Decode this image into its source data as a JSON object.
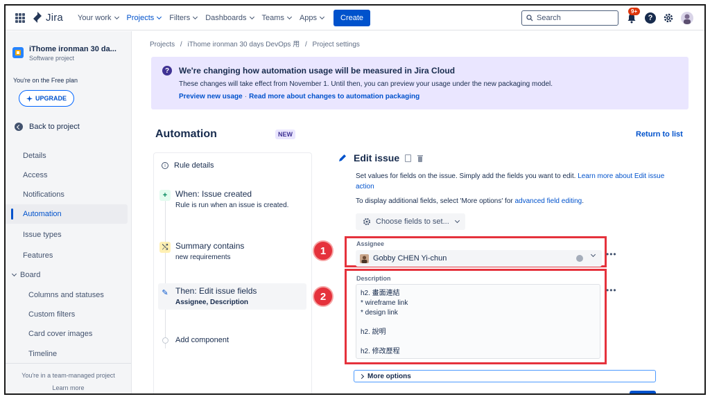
{
  "topnav": {
    "logo": "Jira",
    "items": [
      {
        "label": "Your work",
        "active": false
      },
      {
        "label": "Projects",
        "active": true
      },
      {
        "label": "Filters",
        "active": false
      },
      {
        "label": "Dashboards",
        "active": false
      },
      {
        "label": "Teams",
        "active": false
      },
      {
        "label": "Apps",
        "active": false
      }
    ],
    "create_label": "Create",
    "search_placeholder": "Search",
    "notifications_badge": "9+",
    "help_label": "?"
  },
  "sidebar": {
    "project_name": "iThome ironman 30 da...",
    "project_type": "Software project",
    "plan_text": "You're on the Free plan",
    "upgrade_label": "UPGRADE",
    "back_label": "Back to project",
    "items": [
      {
        "label": "Details"
      },
      {
        "label": "Access"
      },
      {
        "label": "Notifications"
      },
      {
        "label": "Automation",
        "active": true
      },
      {
        "label": "Issue types"
      },
      {
        "label": "Features"
      },
      {
        "label": "Board",
        "expandable": true
      },
      {
        "label": "Columns and statuses",
        "sub": true
      },
      {
        "label": "Custom filters",
        "sub": true
      },
      {
        "label": "Card cover images",
        "sub": true
      },
      {
        "label": "Timeline",
        "sub": true
      }
    ],
    "footer_text": "You're in a team-managed project",
    "footer_link": "Learn more"
  },
  "breadcrumbs": {
    "parts": [
      "Projects",
      "iThome ironman 30 days DevOps 用",
      "Project settings"
    ],
    "separator": "/"
  },
  "banner": {
    "title": "We're changing how automation usage will be measured in Jira Cloud",
    "text": "These changes will take effect from November 1. Until then, you can preview your usage under the new packaging model.",
    "link1": "Preview new usage",
    "link_sep": "·",
    "link2": "Read more about changes to automation packaging"
  },
  "automation": {
    "title": "Automation",
    "new_badge": "NEW",
    "return_label": "Return to list"
  },
  "rule": {
    "details_label": "Rule details",
    "steps": [
      {
        "icon": "+",
        "title": "When: Issue created",
        "sub": "Rule is run when an issue is created."
      },
      {
        "icon": "⤭",
        "title": "Summary contains",
        "sub": "new requirements"
      },
      {
        "icon": "✎",
        "title": "Then: Edit issue fields",
        "sub": "Assignee, Description"
      }
    ],
    "add_component": "Add component"
  },
  "edit": {
    "title": "Edit issue",
    "desc": "Set values for fields on the issue. Simply add the fields you want to edit.",
    "desc_link": "Learn more about Edit issue action",
    "more_text": "To display additional fields, select 'More options' for",
    "more_link": "advanced field editing",
    "more_end": ".",
    "choose_label": "Choose fields to set...",
    "assignee_label": "Assignee",
    "assignee_value": "Gobby CHEN Yi-chun",
    "description_label": "Description",
    "description_lines": [
      "h2. 畫面連結",
      "* wireframe link",
      "* design link",
      "",
      "h2. 說明",
      "",
      "h2. 修改歷程"
    ],
    "more_options_label": "More options",
    "callout_1": "1",
    "callout_2": "2"
  },
  "colors": {
    "primary": "#0052cc",
    "banner_bg": "#eae6ff",
    "callout_red": "#e5323c"
  }
}
